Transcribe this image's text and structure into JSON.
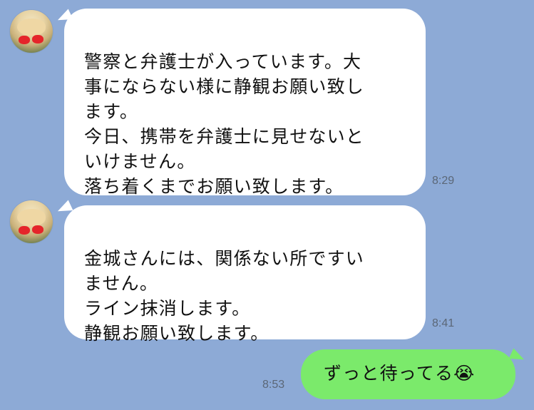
{
  "messages": [
    {
      "text": "警察と弁護士が入っています。大\n事にならない様に静観お願い致し\nます。\n今日、携帯を弁護士に見せないと\nいけません。\n落ち着くまでお願い致します。",
      "time": "8:29"
    },
    {
      "text": "金城さんには、関係ない所ですい\nません。\nライン抹消します。\n静観お願い致します。",
      "time": "8:41"
    }
  ],
  "outgoing": {
    "text": "ずっと待ってる😭",
    "time": "8:53"
  }
}
